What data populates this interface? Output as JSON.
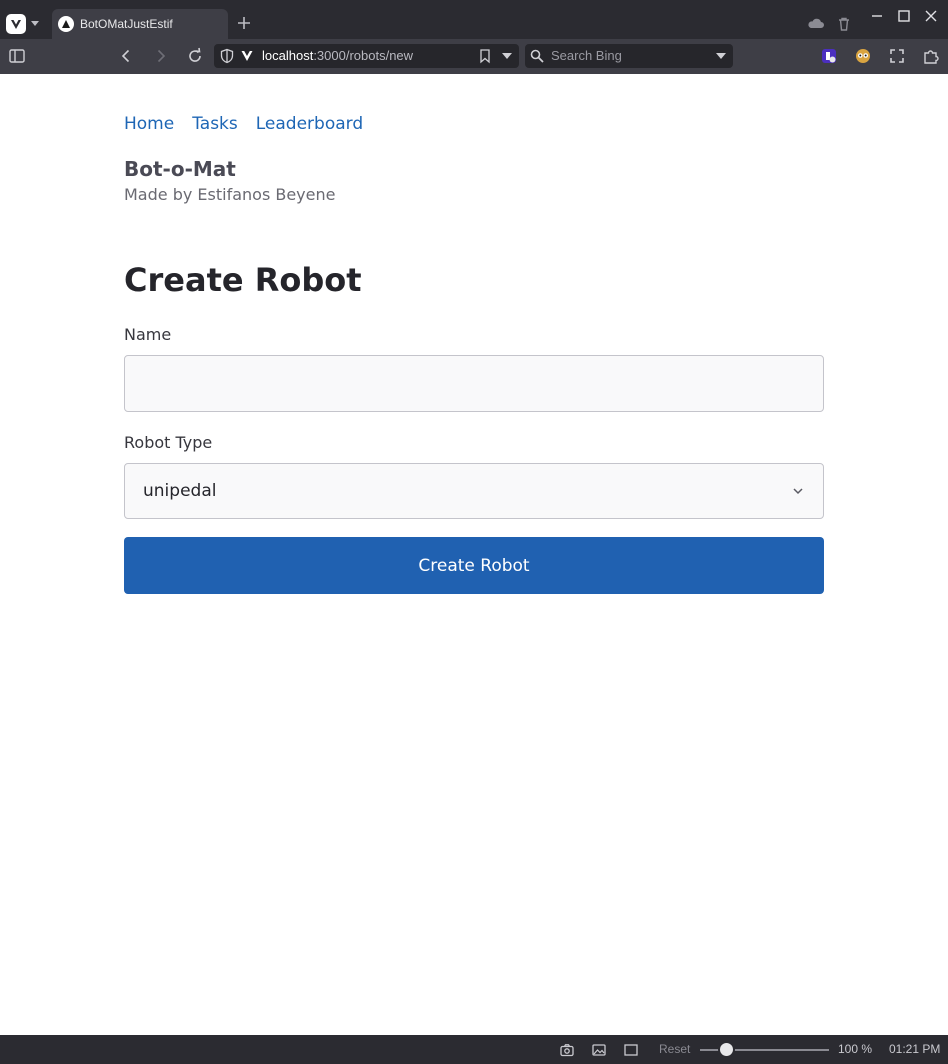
{
  "browser": {
    "tab_title": "BotOMatJustEstif",
    "url_host": "localhost",
    "url_path": ":3000/robots/new",
    "search_placeholder": "Search Bing",
    "zoom_reset_label": "Reset",
    "zoom_level": "100 %",
    "zoom_fraction": 0.2,
    "clock": "01:21 PM",
    "icons": [
      "vivaldi-menu-icon",
      "tab-menu-caret-icon",
      "tab-favicon-icon",
      "new-tab-icon",
      "cloud-icon",
      "trash-icon",
      "minimize-icon",
      "maximize-icon",
      "close-icon",
      "panel-toggle-icon",
      "back-icon",
      "forward-icon",
      "reload-icon",
      "shield-icon",
      "vivaldi-v-icon",
      "bookmark-icon",
      "url-dropdown-icon",
      "search-icon",
      "search-dropdown-icon",
      "extension-privacy-icon",
      "extension-owl-icon",
      "extension-screenshot-icon",
      "extensions-puzzle-icon",
      "camera-icon",
      "image-icon",
      "window-icon"
    ]
  },
  "nav": {
    "links": [
      "Home",
      "Tasks",
      "Leaderboard"
    ]
  },
  "brand": {
    "title": "Bot-o-Mat",
    "subtitle": "Made by Estifanos Beyene"
  },
  "form": {
    "heading": "Create Robot",
    "name_label": "Name",
    "name_value": "",
    "type_label": "Robot Type",
    "type_value": "unipedal",
    "submit_label": "Create Robot"
  },
  "colors": {
    "link": "#1e66b5",
    "button": "#2061b1",
    "chrome_dark": "#2b2b31",
    "chrome_mid": "#3e3e46"
  }
}
